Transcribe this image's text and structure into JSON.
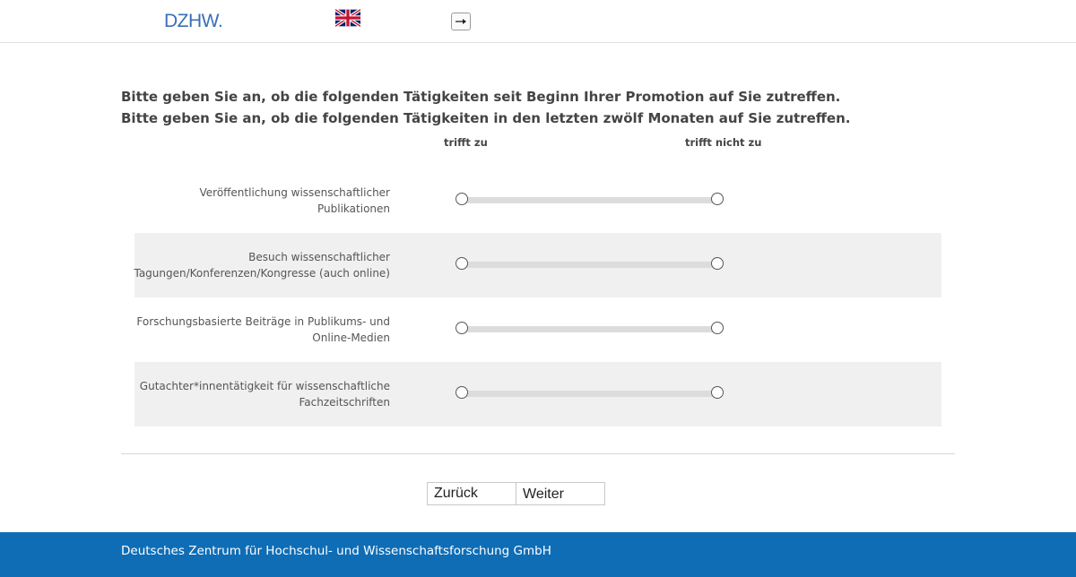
{
  "header": {
    "logo_text": "DZHW.",
    "language_flag": "uk-flag-icon",
    "logout_icon": "logout-arrow-icon"
  },
  "question": {
    "line1": "Bitte geben Sie an, ob die folgenden Tätigkeiten seit Beginn Ihrer Promotion auf Sie zutreffen.",
    "line2": "Bitte geben Sie an, ob die folgenden Tätigkeiten in den letzten zwölf Monaten auf Sie zutreffen."
  },
  "scale": {
    "left_label": "trifft zu",
    "right_label": "trifft nicht zu"
  },
  "items": [
    {
      "label_line1": "Veröffentlichung wissenschaftlicher",
      "label_line2": "Publikationen"
    },
    {
      "label_line1": "Besuch wissenschaftlicher",
      "label_line2": "Tagungen/Konferenzen/Kongresse (auch online)"
    },
    {
      "label_line1": "Forschungsbasierte Beiträge in Publikums- und",
      "label_line2": "Online-Medien"
    },
    {
      "label_line1": "Gutachter*innentätigkeit für wissenschaftliche",
      "label_line2": "Fachzeitschriften"
    }
  ],
  "nav": {
    "back_label": "Zurück",
    "next_label": "Weiter"
  },
  "footer": {
    "text": "Deutsches Zentrum für Hochschul- und Wissenschaftsforschung GmbH"
  },
  "colors": {
    "brand_blue": "#0f6db5",
    "logo_blue": "#3a6fb5",
    "row_shade": "#f0f0f0"
  }
}
